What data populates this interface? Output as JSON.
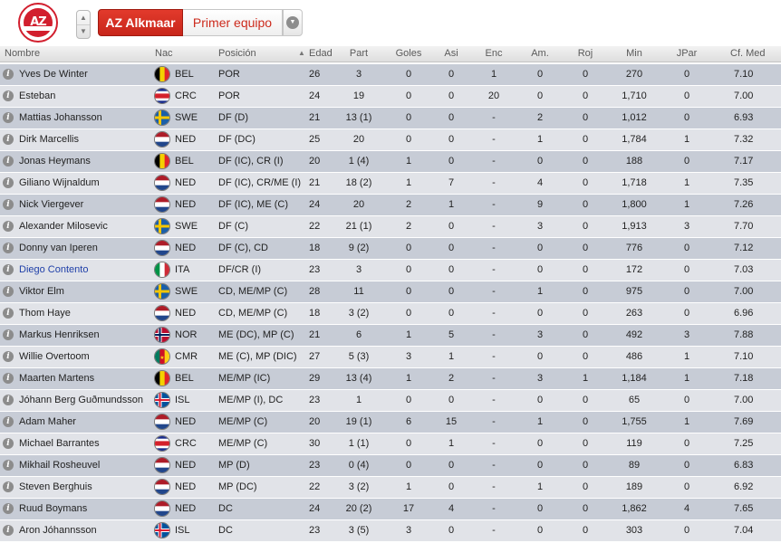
{
  "header": {
    "logo_text": "AZ",
    "club": "AZ Alkmaar",
    "team": "Primer equipo"
  },
  "columns": {
    "name": "Nombre",
    "nat": "Nac",
    "pos": "Posición",
    "age": "Edad",
    "apps": "Part",
    "goals": "Goles",
    "assists": "Asi",
    "pom": "Enc",
    "yellow": "Am.",
    "red": "Roj",
    "mins": "Min",
    "pom_award": "JPar",
    "rating": "Cf. Med"
  },
  "players": [
    {
      "name": "Yves De Winter",
      "nat": "BEL",
      "pos": "POR",
      "age": "26",
      "apps": "3",
      "goals": "0",
      "assists": "0",
      "pom": "1",
      "yellow": "0",
      "red": "0",
      "mins": "270",
      "pom_award": "0",
      "rating": "7.10"
    },
    {
      "name": "Esteban",
      "nat": "CRC",
      "pos": "POR",
      "age": "24",
      "apps": "19",
      "goals": "0",
      "assists": "0",
      "pom": "20",
      "yellow": "0",
      "red": "0",
      "mins": "1,710",
      "pom_award": "0",
      "rating": "7.00"
    },
    {
      "name": "Mattias Johansson",
      "nat": "SWE",
      "pos": "DF (D)",
      "age": "21",
      "apps": "13 (1)",
      "goals": "0",
      "assists": "0",
      "pom": "-",
      "yellow": "2",
      "red": "0",
      "mins": "1,012",
      "pom_award": "0",
      "rating": "6.93"
    },
    {
      "name": "Dirk Marcellis",
      "nat": "NED",
      "pos": "DF (DC)",
      "age": "25",
      "apps": "20",
      "goals": "0",
      "assists": "0",
      "pom": "-",
      "yellow": "1",
      "red": "0",
      "mins": "1,784",
      "pom_award": "1",
      "rating": "7.32"
    },
    {
      "name": "Jonas Heymans",
      "nat": "BEL",
      "pos": "DF (IC), CR (I)",
      "age": "20",
      "apps": "1 (4)",
      "goals": "1",
      "assists": "0",
      "pom": "-",
      "yellow": "0",
      "red": "0",
      "mins": "188",
      "pom_award": "0",
      "rating": "7.17"
    },
    {
      "name": "Giliano Wijnaldum",
      "nat": "NED",
      "pos": "DF (IC), CR/ME (I)",
      "age": "21",
      "apps": "18 (2)",
      "goals": "1",
      "assists": "7",
      "pom": "-",
      "yellow": "4",
      "red": "0",
      "mins": "1,718",
      "pom_award": "1",
      "rating": "7.35"
    },
    {
      "name": "Nick Viergever",
      "nat": "NED",
      "pos": "DF (IC), ME (C)",
      "age": "24",
      "apps": "20",
      "goals": "2",
      "assists": "1",
      "pom": "-",
      "yellow": "9",
      "red": "0",
      "mins": "1,800",
      "pom_award": "1",
      "rating": "7.26"
    },
    {
      "name": "Alexander Milosevic",
      "nat": "SWE",
      "pos": "DF (C)",
      "age": "22",
      "apps": "21 (1)",
      "goals": "2",
      "assists": "0",
      "pom": "-",
      "yellow": "3",
      "red": "0",
      "mins": "1,913",
      "pom_award": "3",
      "rating": "7.70"
    },
    {
      "name": "Donny van Iperen",
      "nat": "NED",
      "pos": "DF (C), CD",
      "age": "18",
      "apps": "9 (2)",
      "goals": "0",
      "assists": "0",
      "pom": "-",
      "yellow": "0",
      "red": "0",
      "mins": "776",
      "pom_award": "0",
      "rating": "7.12"
    },
    {
      "name": "Diego Contento",
      "nat": "ITA",
      "pos": "DF/CR (I)",
      "age": "23",
      "apps": "3",
      "goals": "0",
      "assists": "0",
      "pom": "-",
      "yellow": "0",
      "red": "0",
      "mins": "172",
      "pom_award": "0",
      "rating": "7.03",
      "link": true
    },
    {
      "name": "Viktor Elm",
      "nat": "SWE",
      "pos": "CD, ME/MP (C)",
      "age": "28",
      "apps": "11",
      "goals": "0",
      "assists": "0",
      "pom": "-",
      "yellow": "1",
      "red": "0",
      "mins": "975",
      "pom_award": "0",
      "rating": "7.00"
    },
    {
      "name": "Thom Haye",
      "nat": "NED",
      "pos": "CD, ME/MP (C)",
      "age": "18",
      "apps": "3 (2)",
      "goals": "0",
      "assists": "0",
      "pom": "-",
      "yellow": "0",
      "red": "0",
      "mins": "263",
      "pom_award": "0",
      "rating": "6.96"
    },
    {
      "name": "Markus Henriksen",
      "nat": "NOR",
      "pos": "ME (DC), MP (C)",
      "age": "21",
      "apps": "6",
      "goals": "1",
      "assists": "5",
      "pom": "-",
      "yellow": "3",
      "red": "0",
      "mins": "492",
      "pom_award": "3",
      "rating": "7.88"
    },
    {
      "name": "Willie Overtoom",
      "nat": "CMR",
      "pos": "ME (C), MP (DIC)",
      "age": "27",
      "apps": "5 (3)",
      "goals": "3",
      "assists": "1",
      "pom": "-",
      "yellow": "0",
      "red": "0",
      "mins": "486",
      "pom_award": "1",
      "rating": "7.10"
    },
    {
      "name": "Maarten Martens",
      "nat": "BEL",
      "pos": "ME/MP (IC)",
      "age": "29",
      "apps": "13 (4)",
      "goals": "1",
      "assists": "2",
      "pom": "-",
      "yellow": "3",
      "red": "1",
      "mins": "1,184",
      "pom_award": "1",
      "rating": "7.18"
    },
    {
      "name": "Jóhann Berg Guðmundsson",
      "nat": "ISL",
      "pos": "ME/MP (I), DC",
      "age": "23",
      "apps": "1",
      "goals": "0",
      "assists": "0",
      "pom": "-",
      "yellow": "0",
      "red": "0",
      "mins": "65",
      "pom_award": "0",
      "rating": "7.00"
    },
    {
      "name": "Adam Maher",
      "nat": "NED",
      "pos": "ME/MP (C)",
      "age": "20",
      "apps": "19 (1)",
      "goals": "6",
      "assists": "15",
      "pom": "-",
      "yellow": "1",
      "red": "0",
      "mins": "1,755",
      "pom_award": "1",
      "rating": "7.69"
    },
    {
      "name": "Michael Barrantes",
      "nat": "CRC",
      "pos": "ME/MP (C)",
      "age": "30",
      "apps": "1 (1)",
      "goals": "0",
      "assists": "1",
      "pom": "-",
      "yellow": "0",
      "red": "0",
      "mins": "119",
      "pom_award": "0",
      "rating": "7.25"
    },
    {
      "name": "Mikhail Rosheuvel",
      "nat": "NED",
      "pos": "MP (D)",
      "age": "23",
      "apps": "0 (4)",
      "goals": "0",
      "assists": "0",
      "pom": "-",
      "yellow": "0",
      "red": "0",
      "mins": "89",
      "pom_award": "0",
      "rating": "6.83"
    },
    {
      "name": "Steven Berghuis",
      "nat": "NED",
      "pos": "MP (DC)",
      "age": "22",
      "apps": "3 (2)",
      "goals": "1",
      "assists": "0",
      "pom": "-",
      "yellow": "1",
      "red": "0",
      "mins": "189",
      "pom_award": "0",
      "rating": "6.92"
    },
    {
      "name": "Ruud Boymans",
      "nat": "NED",
      "pos": "DC",
      "age": "24",
      "apps": "20 (2)",
      "goals": "17",
      "assists": "4",
      "pom": "-",
      "yellow": "0",
      "red": "0",
      "mins": "1,862",
      "pom_award": "4",
      "rating": "7.65"
    },
    {
      "name": "Aron Jóhannsson",
      "nat": "ISL",
      "pos": "DC",
      "age": "23",
      "apps": "3 (5)",
      "goals": "3",
      "assists": "0",
      "pom": "-",
      "yellow": "0",
      "red": "0",
      "mins": "303",
      "pom_award": "0",
      "rating": "7.04"
    }
  ],
  "flag_colors": {
    "BEL": [
      "#000000",
      "#f3d000",
      "#e0252a"
    ],
    "CRC": [
      "#1a2d8c",
      "#ffffff",
      "#d4202b",
      "#ffffff",
      "#1a2d8c"
    ],
    "SWE": [
      "#1b5fa8",
      "#f6c600"
    ],
    "NED": [
      "#ad1c28",
      "#ffffff",
      "#21468b"
    ],
    "ITA": [
      "#009246",
      "#ffffff",
      "#ce2b37"
    ],
    "NOR": [
      "#ba0c2f",
      "#ffffff",
      "#00205b"
    ],
    "CMR": [
      "#007a5e",
      "#ce1126",
      "#fcd116"
    ],
    "ISL": [
      "#02529c",
      "#ffffff",
      "#dc1e35"
    ]
  }
}
